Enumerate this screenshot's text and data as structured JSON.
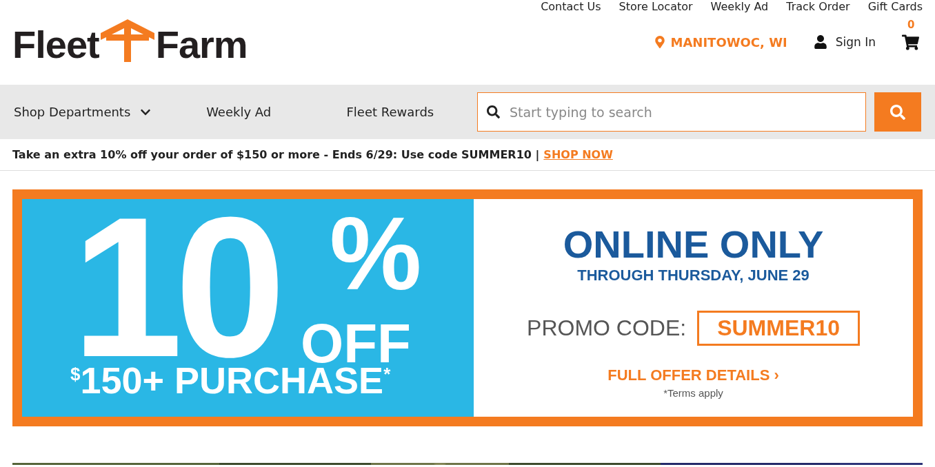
{
  "utility_links": [
    "Contact Us",
    "Store Locator",
    "Weekly Ad",
    "Track Order",
    "Gift Cards"
  ],
  "logo": {
    "left": "Fleet",
    "right": "Farm"
  },
  "store": {
    "label": "MANITOWOC, WI"
  },
  "account": {
    "label": "Sign In"
  },
  "cart": {
    "count": "0"
  },
  "nav": [
    {
      "label": "Shop Departments",
      "kind": "dropdown"
    },
    {
      "label": "Weekly Ad",
      "kind": "link"
    },
    {
      "label": "Fleet Rewards",
      "kind": "link"
    }
  ],
  "search": {
    "placeholder": "Start typing to search"
  },
  "promo_bar": {
    "text": "Take an extra 10% off your order of $150 or more - Ends 6/29: Use code SUMMER10 |",
    "link": "SHOP NOW"
  },
  "banner": {
    "number": "10",
    "percent": "%",
    "off": "OFF",
    "purchase": "$^{$}$150+ PURCHASE$^{*}$",
    "headline": "ONLINE ONLY",
    "subhead": "THROUGH THURSDAY, JUNE 29",
    "promo_label": "PROMO CODE:",
    "promo_code": "SUMMER10",
    "details_link": "FULL OFFER DETAILS ›",
    "terms": "*Terms apply"
  }
}
